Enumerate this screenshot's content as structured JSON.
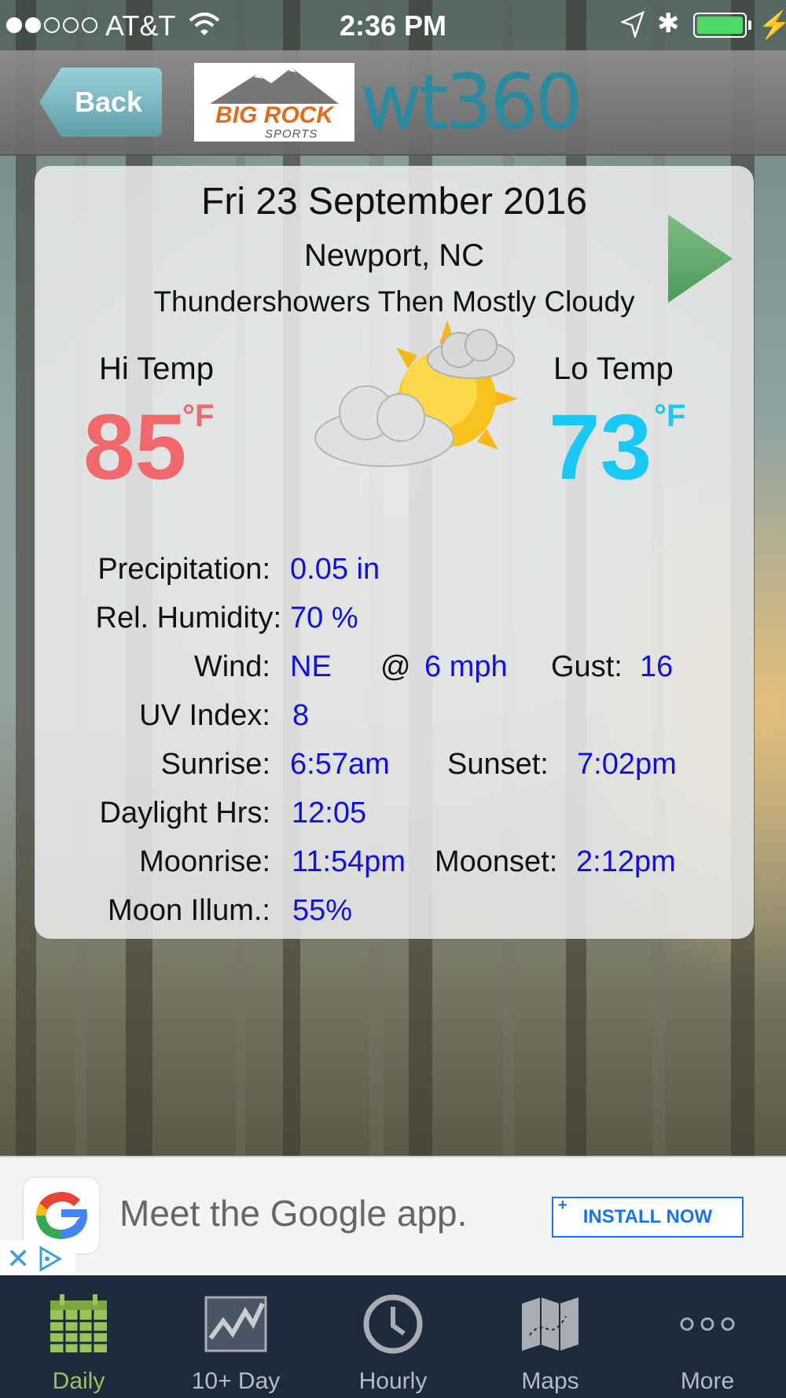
{
  "status_bar": {
    "carrier": "AT&T",
    "time": "2:36 PM",
    "signal_bars_filled": 2,
    "signal_bars_total": 5,
    "battery_level": 1.0
  },
  "header": {
    "back_label": "Back",
    "logo_text": "BIG ROCK",
    "logo_subtext": "SPORTS",
    "brand": "wt360"
  },
  "forecast": {
    "date": "Fri 23 September 2016",
    "location": "Newport, NC",
    "condition": "Thundershowers Then Mostly Cloudy",
    "hi_label": "Hi Temp",
    "hi_value": "85",
    "hi_unit": "°F",
    "lo_label": "Lo Temp",
    "lo_value": "73",
    "lo_unit": "°F",
    "icon": "partly-cloudy-sun-icon",
    "details": {
      "precipitation_label": "Precipitation:",
      "precipitation": "0.05 in",
      "humidity_label": "Rel. Humidity:",
      "humidity": "70 %",
      "wind_label": "Wind:",
      "wind_dir": "NE",
      "wind_at": "@",
      "wind_speed": "6 mph",
      "gust_label": "Gust:",
      "gust": "16",
      "uv_label": "UV Index:",
      "uv": "8",
      "sunrise_label": "Sunrise:",
      "sunrise": "6:57am",
      "sunset_label": "Sunset:",
      "sunset": "7:02pm",
      "daylight_label": "Daylight Hrs:",
      "daylight": "12:05",
      "moonrise_label": "Moonrise:",
      "moonrise": "11:54pm",
      "moonset_label": "Moonset:",
      "moonset": "2:12pm",
      "moon_illum_label": "Moon Illum.:",
      "moon_illum": "55%"
    }
  },
  "ad": {
    "text": "Meet the Google app.",
    "button": "INSTALL NOW"
  },
  "tabs": [
    {
      "label": "Daily",
      "icon": "calendar-icon",
      "active": true
    },
    {
      "label": "10+ Day",
      "icon": "trend-chart-icon",
      "active": false
    },
    {
      "label": "Hourly",
      "icon": "clock-icon",
      "active": false
    },
    {
      "label": "Maps",
      "icon": "map-icon",
      "active": false
    },
    {
      "label": "More",
      "icon": "more-dots-icon",
      "active": false
    }
  ],
  "colors": {
    "hi_temp": "#f0686a",
    "lo_temp": "#19c8f4",
    "value_text": "#1010e0",
    "tab_active": "#9ac35a",
    "tab_bar": "#1c2a3c"
  }
}
